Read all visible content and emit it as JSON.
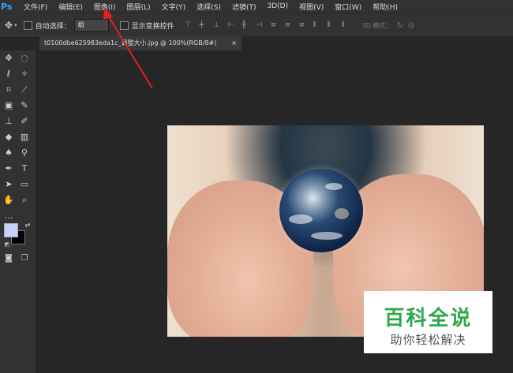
{
  "menubar": {
    "logo": "Ps",
    "items": [
      "文件(F)",
      "编辑(E)",
      "图像(I)",
      "图层(L)",
      "文字(Y)",
      "选择(S)",
      "滤镜(T)",
      "3D(D)",
      "视图(V)",
      "窗口(W)",
      "帮助(H)"
    ]
  },
  "options": {
    "auto_select_label": "自动选择：",
    "auto_select_value": "组",
    "show_transform_label": "显示变换控件",
    "mode_3d_label": "3D 模式："
  },
  "document_tab": {
    "title": "t0100dbe625983eda1c_调整大小.jpg @ 100%(RGB/8#)",
    "close": "×"
  },
  "watermark": {
    "title": "百科全说",
    "subtitle": "助你轻松解决"
  },
  "colors": {
    "foreground": "#c5d3fb",
    "background": "#000000",
    "annotation_arrow": "#e02020"
  },
  "tools": [
    "move-icon",
    "marquee-icon",
    "lasso-icon",
    "magic-wand-icon",
    "crop-icon",
    "eyedropper-icon",
    "frame-icon",
    "brush-icon",
    "stamp-icon",
    "history-brush-icon",
    "eraser-icon",
    "gradient-icon",
    "blur-icon",
    "dodge-icon",
    "pen-icon",
    "type-icon",
    "path-select-icon",
    "rectangle-icon",
    "hand-icon",
    "zoom-icon",
    "more-tools-icon"
  ]
}
